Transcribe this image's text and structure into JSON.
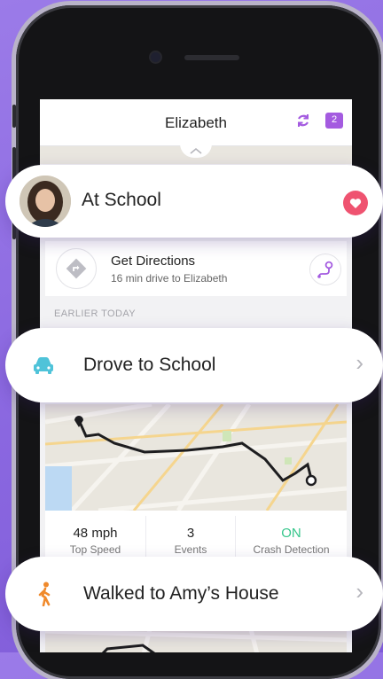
{
  "header": {
    "title": "Elizabeth",
    "message_count": "2"
  },
  "location": {
    "label": "At School",
    "avatar": "avatar-photo",
    "favorite_icon": "heart-icon",
    "accent": "#ef5370"
  },
  "directions": {
    "title": "Get Directions",
    "subtitle": "16 min drive to Elizabeth"
  },
  "section_label": "EARLIER TODAY",
  "drive": {
    "label": "Drove to School",
    "icon": "car-icon",
    "icon_color": "#4fc3d9"
  },
  "stats": [
    {
      "value": "48 mph",
      "label": "Top Speed"
    },
    {
      "value": "3",
      "label": "Events"
    },
    {
      "value": "ON",
      "label": "Crash Detection",
      "value_color": "#35c68b"
    }
  ],
  "walk": {
    "label": "Walked to Amy’s House",
    "icon": "walking-person-icon",
    "icon_color": "#f08a2c"
  },
  "colors": {
    "brand": "#a45be0",
    "background": "#8a67e0"
  }
}
